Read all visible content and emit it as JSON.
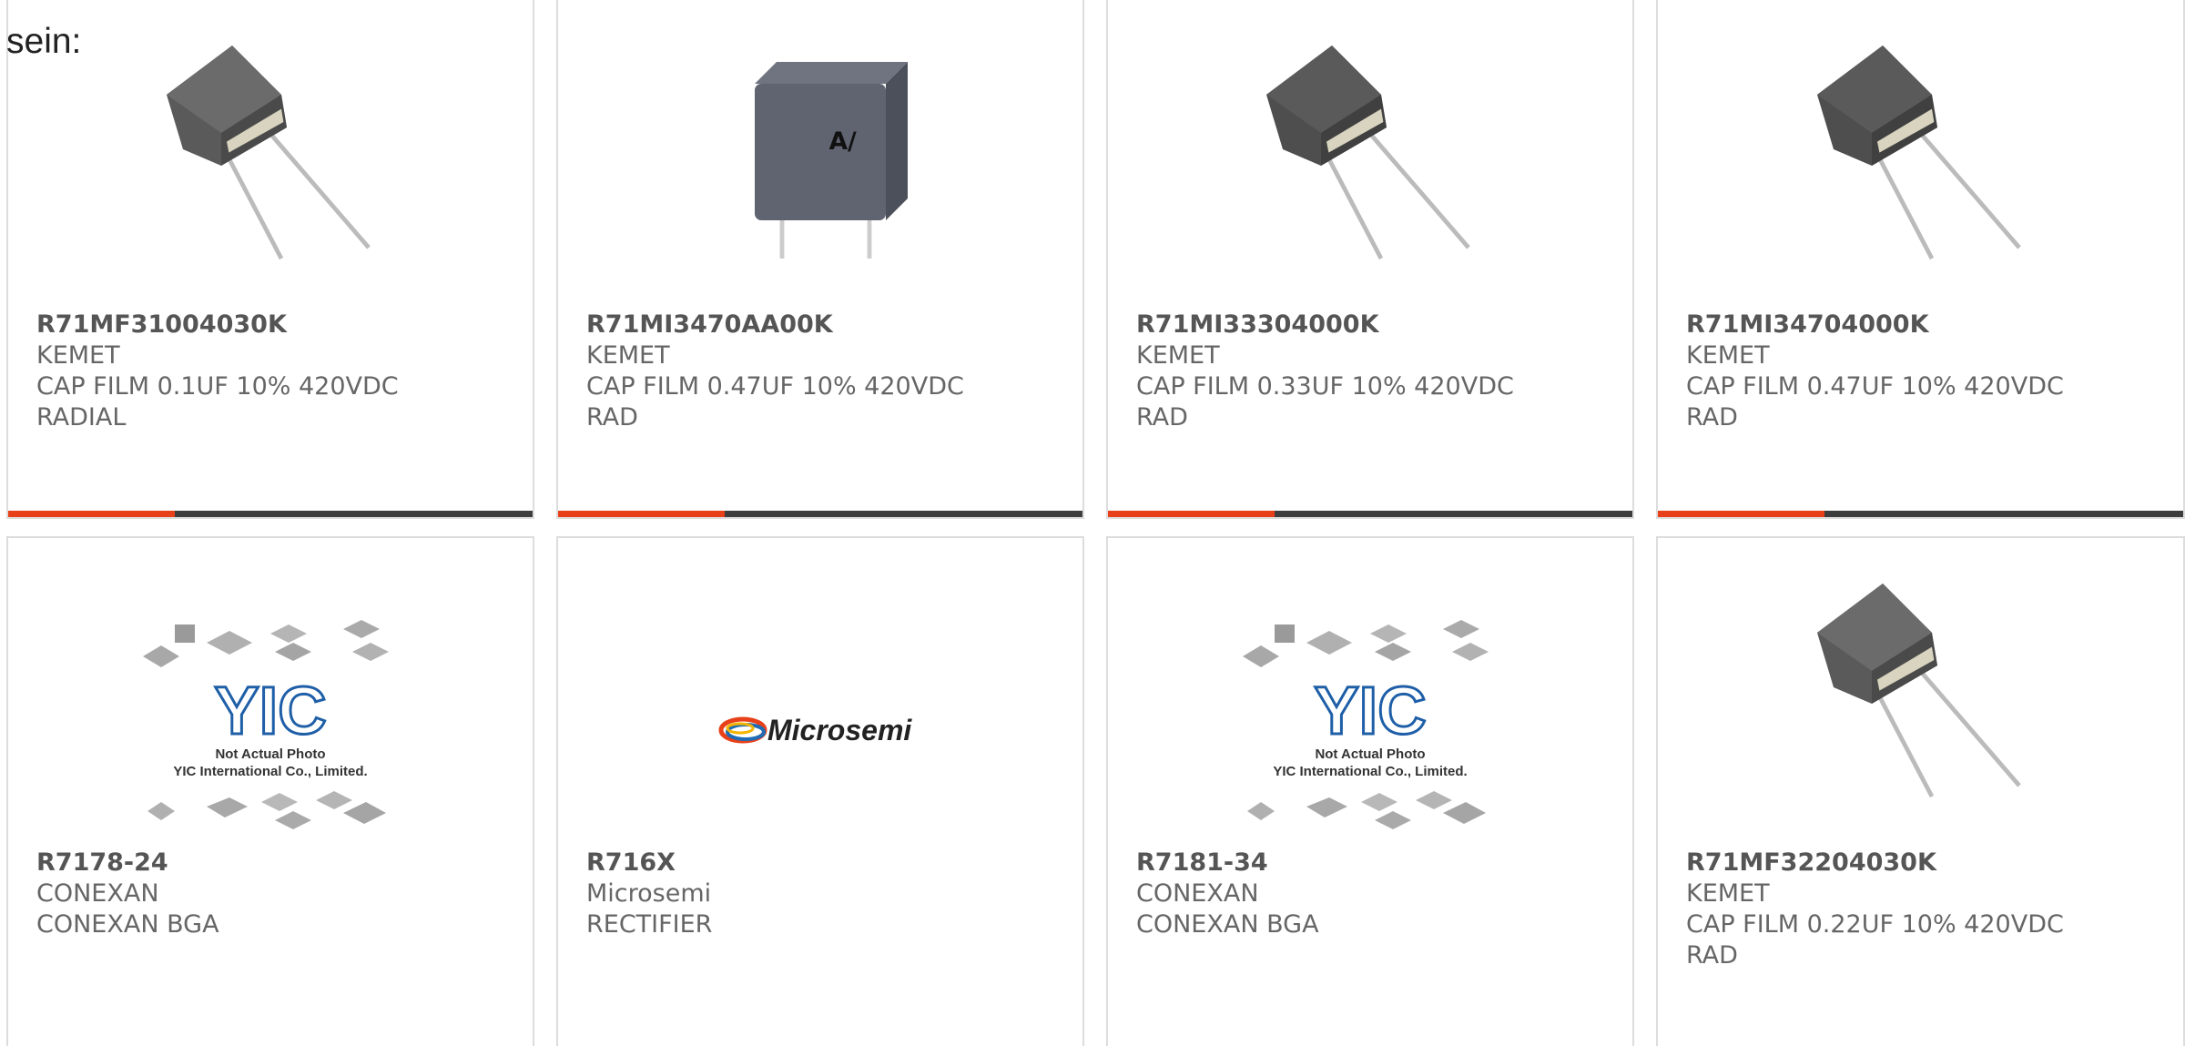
{
  "heading": "sein:",
  "colors": {
    "accent": "#e8411a",
    "bar": "#3d3d3d",
    "border": "#dddddd",
    "text": "#666666"
  },
  "cards": [
    {
      "part": "R71MF31004030K",
      "maker": "KEMET",
      "desc_lines": [
        "CAP FILM 0.1UF 10% 420VDC",
        "RADIAL"
      ],
      "image": "capacitor-radial-icon"
    },
    {
      "part": "R71MI3470AA00K",
      "maker": "KEMET",
      "desc_lines": [
        "CAP FILM 0.47UF 10% 420VDC",
        "RAD"
      ],
      "image": "capacitor-box-icon"
    },
    {
      "part": "R71MI33304000K",
      "maker": "KEMET",
      "desc_lines": [
        "CAP FILM 0.33UF 10% 420VDC",
        "RAD"
      ],
      "image": "capacitor-radial-icon"
    },
    {
      "part": "R71MI34704000K",
      "maker": "KEMET",
      "desc_lines": [
        "CAP FILM 0.47UF 10% 420VDC",
        "RAD"
      ],
      "image": "capacitor-radial-icon"
    },
    {
      "part": "R7178-24",
      "maker": "CONEXAN",
      "desc_lines": [
        "CONEXAN BGA"
      ],
      "image": "yic-placeholder-icon",
      "image_text": [
        "YIC",
        "Not Actual Photo",
        "YIC International Co., Limited."
      ]
    },
    {
      "part": "R716X",
      "maker": "Microsemi",
      "desc_lines": [
        "RECTIFIER"
      ],
      "image": "microsemi-logo-icon",
      "image_text": [
        "Microsemi"
      ]
    },
    {
      "part": "R7181-34",
      "maker": "CONEXAN",
      "desc_lines": [
        "CONEXAN BGA"
      ],
      "image": "yic-placeholder-icon",
      "image_text": [
        "YIC",
        "Not Actual Photo",
        "YIC International Co., Limited."
      ]
    },
    {
      "part": "R71MF32204030K",
      "maker": "KEMET",
      "desc_lines": [
        "CAP FILM 0.22UF 10% 420VDC",
        "RAD"
      ],
      "image": "capacitor-radial-icon"
    }
  ]
}
